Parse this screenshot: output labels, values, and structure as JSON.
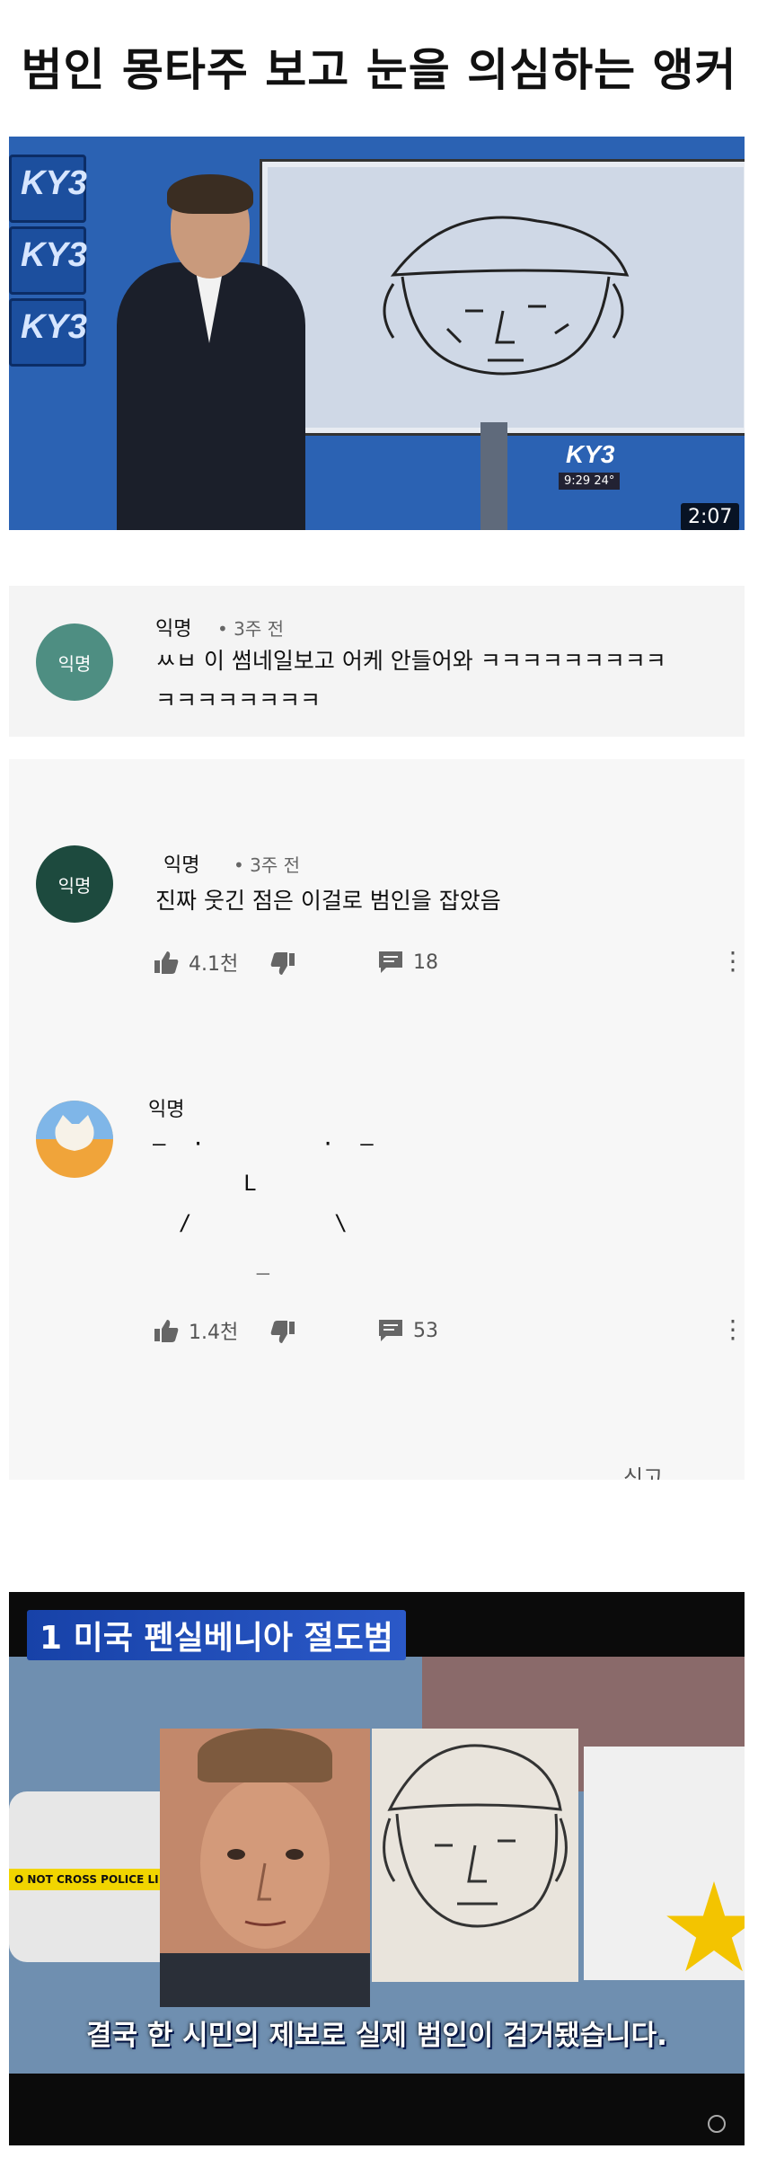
{
  "title": "범인 몽타주 보고 눈을 의심하는 앵커",
  "video1": {
    "station_logo": "KY3",
    "ticker": "9:29 24°",
    "duration": "2:07"
  },
  "comments": [
    {
      "avatar_label": "익명",
      "avatar_color": "#4e8e82",
      "author": "익명",
      "time": "• 3주 전",
      "lines": [
        "ㅆㅂ 이 썸네일보고 어케 안들어와 ㅋㅋㅋㅋㅋㅋㅋㅋㅋ",
        "ㅋㅋㅋㅋㅋㅋㅋㅋ"
      ]
    },
    {
      "avatar_label": "익명",
      "avatar_color": "#1d4a3e",
      "author": "익명",
      "time": "• 3주 전",
      "text": "진짜 웃긴 점은 이걸로 범인을 잡았음",
      "likes": "4.1천",
      "replies": "18"
    },
    {
      "avatar_color": "#f0a43a",
      "author": "익명",
      "ascii_lines": [
        "—  ·         ·  —",
        "       L",
        "  /           \\",
        "        _"
      ],
      "likes": "1.4천",
      "replies": "53",
      "report": "신고"
    }
  ],
  "video2": {
    "title": "1 미국 펜실베니아 절도범",
    "caption": "결국 한 시민의 제보로 실제 범인이 검거됐습니다.",
    "tape_text": "O NOT CROSS  POLICE LI"
  },
  "icons": {
    "like": "thumb-up-icon",
    "dislike": "thumb-down-icon",
    "reply": "comment-icon",
    "more": "more-vertical-icon"
  }
}
